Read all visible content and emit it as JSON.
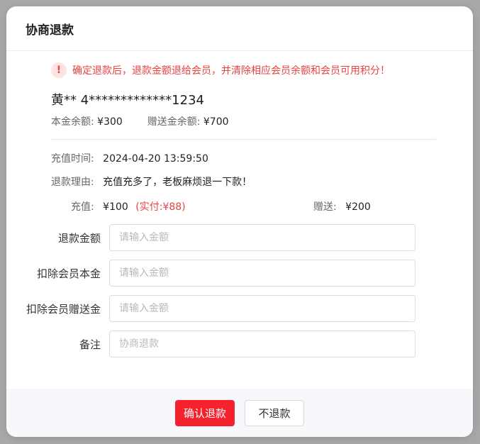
{
  "dialog": {
    "title": "协商退款"
  },
  "warning": {
    "icon": "exclamation-icon",
    "icon_glyph": "!",
    "text": "确定退款后，退款金额退给会员，并清除相应会员余额和会员可用积分！"
  },
  "member": {
    "name": "黄** 4*************1234",
    "principal_label": "本金余额:",
    "principal_value": "¥300",
    "bonus_label": "赠送金余额:",
    "bonus_value": "¥700"
  },
  "record": {
    "time_label": "充值时间:",
    "time_value": "2024-04-20 13:59:50",
    "reason_label": "退款理由:",
    "reason_value": "充值充多了，老板麻烦退一下款！",
    "recharge_label": "充值:",
    "recharge_value": "¥100",
    "actual_paid": "(实付:¥88)",
    "gift_label": "赠送:",
    "gift_value": "¥200"
  },
  "form": {
    "refund_amount_label": "退款金额",
    "refund_amount_placeholder": "请输入金额",
    "deduct_principal_label": "扣除会员本金",
    "deduct_principal_placeholder": "请输入金额",
    "deduct_bonus_label": "扣除会员赠送金",
    "deduct_bonus_placeholder": "请输入金额",
    "remark_label": "备注",
    "remark_placeholder": "协商退款"
  },
  "footer": {
    "confirm_label": "确认退款",
    "cancel_label": "不退款"
  },
  "colors": {
    "accent": "#f5222d",
    "warning_text": "#e84343",
    "footer_bg": "#f6f8fb"
  }
}
